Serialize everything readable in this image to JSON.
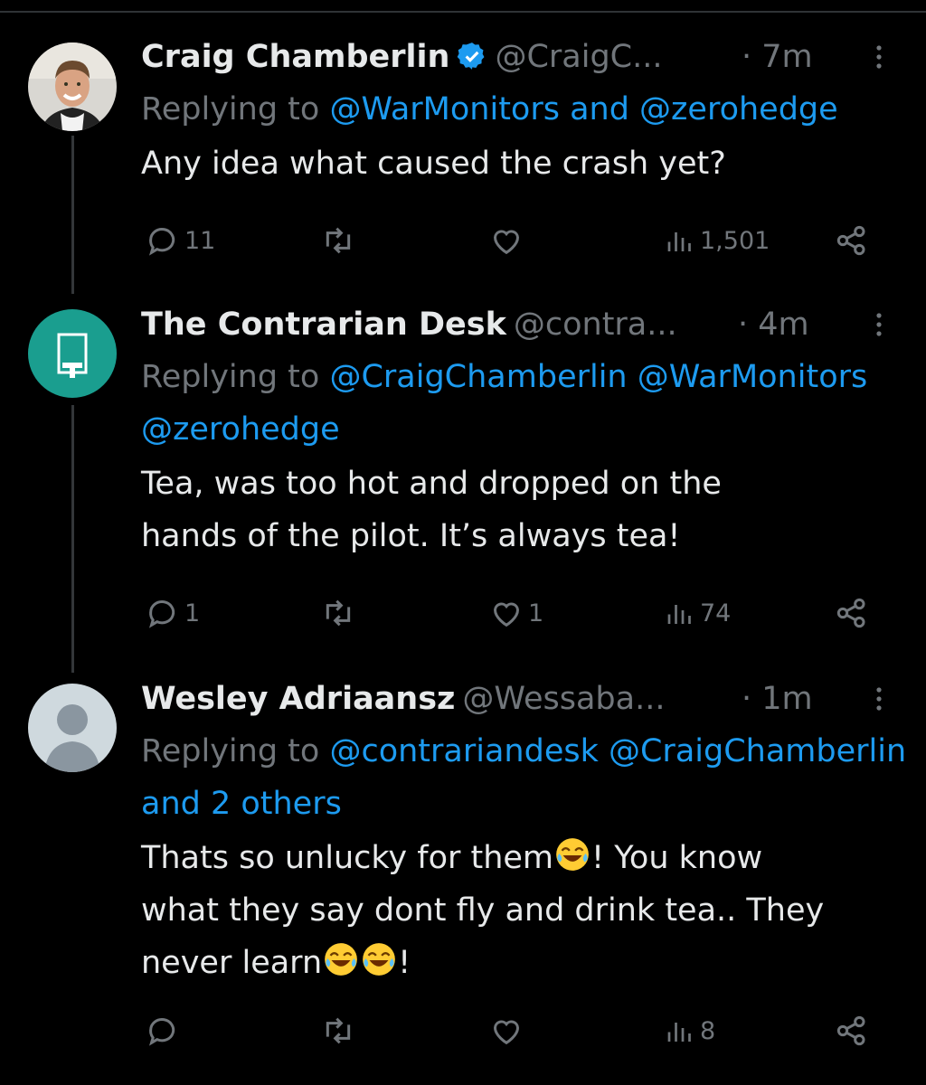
{
  "tweets": [
    {
      "name": "Craig Chamberlin",
      "verified": true,
      "handle": "@CraigC...",
      "time": "· 7m",
      "reply_prefix": "Replying to",
      "reply_mentions": "@WarMonitors and @zerohedge",
      "reply_line2": "",
      "body_lines": [
        "Any idea what caused the crash yet?"
      ],
      "actions": {
        "replies": "11",
        "retweets": "",
        "likes": "",
        "views": "1,501"
      }
    },
    {
      "name": "The Contrarian Desk",
      "verified": false,
      "handle": "@contra...",
      "time": "· 4m",
      "reply_prefix": "Replying to",
      "reply_mentions": "@CraigChamberlin @WarMonitors",
      "reply_line2": "@zerohedge",
      "body_lines": [
        "Tea, was too hot and dropped on the",
        "hands of the pilot. It’s always tea!"
      ],
      "actions": {
        "replies": "1",
        "retweets": "",
        "likes": "1",
        "views": "74"
      }
    },
    {
      "name": "Wesley Adriaansz",
      "verified": false,
      "handle": "@Wessaba...",
      "time": "· 1m",
      "reply_prefix": "Replying to",
      "reply_mentions": "@contrariandesk @CraigChamberlin",
      "reply_line2": "and 2 others",
      "body_lines": [
        "Thats so unlucky for them",
        "! You know",
        "what they say dont fly and drink tea.. They",
        "never learn",
        "!"
      ],
      "actions": {
        "replies": "",
        "retweets": "",
        "likes": "",
        "views": "8"
      }
    }
  ],
  "colors": {
    "background": "#000000",
    "text": "#e7e9ea",
    "muted": "#71767b",
    "link": "#1d9bf0",
    "contrarian_avatar": "#1a9e8f",
    "verified": "#1d9bf0"
  },
  "icons": [
    "more-icon",
    "verified-icon",
    "reply-icon",
    "retweet-icon",
    "like-icon",
    "views-icon",
    "share-icon",
    "laughing-emoji-icon"
  ]
}
